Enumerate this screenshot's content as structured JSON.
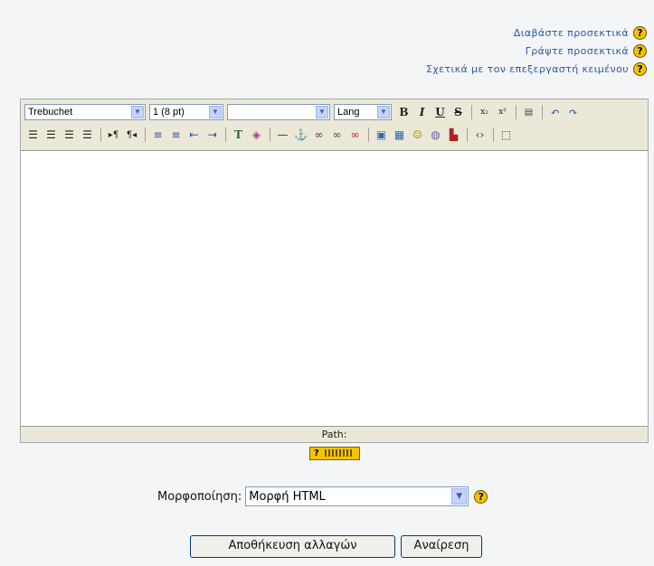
{
  "help_links": [
    {
      "label": "Διαβάστε προσεκτικά",
      "icon": "help-question-icon",
      "glyph": "?"
    },
    {
      "label": "Γράψτε προσεκτικά",
      "icon": "help-question-icon",
      "glyph": "?"
    },
    {
      "label": "Σχετικά με τον επεξεργαστή κειμένου",
      "icon": "help-question-icon",
      "glyph": "?"
    }
  ],
  "toolbar": {
    "font_family": "Trebuchet",
    "font_size": "1 (8 pt)",
    "heading": "",
    "lang": "Lang",
    "bold": "B",
    "italic": "I",
    "underline": "U",
    "strike": "S"
  },
  "editor": {
    "path_label": "Path:"
  },
  "keyboard_help": {
    "glyph": "?"
  },
  "format": {
    "label": "Μορφοποίηση:",
    "selected": "Μορφή HTML",
    "help_glyph": "?"
  },
  "buttons": {
    "save": "Αποθήκευση αλλαγών",
    "cancel": "Αναίρεση"
  },
  "colors": {
    "accent_link": "#2a5aa6",
    "help_icon": "#f5c400",
    "toolbar_bg": "#ebe8d7"
  }
}
